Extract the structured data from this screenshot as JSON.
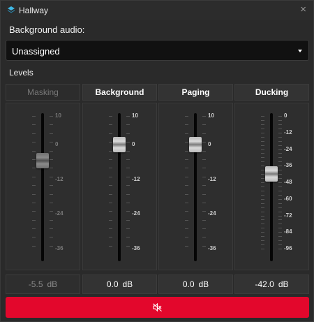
{
  "window": {
    "title": "Hallway",
    "close_glyph": "×"
  },
  "background_audio": {
    "label": "Background audio:",
    "selected": "Unassigned"
  },
  "levels": {
    "label": "Levels",
    "unit": "dB",
    "channels": [
      {
        "name": "Masking",
        "value": "-5.5",
        "level_db": -5.5,
        "enabled": false,
        "scale": [
          "10",
          "0",
          "-12",
          "-24",
          "-36"
        ],
        "range_db": [
          10,
          -36
        ]
      },
      {
        "name": "Background",
        "value": "0.0",
        "level_db": 0,
        "enabled": true,
        "scale": [
          "10",
          "0",
          "-12",
          "-24",
          "-36"
        ],
        "range_db": [
          10,
          -36
        ]
      },
      {
        "name": "Paging",
        "value": "0.0",
        "level_db": 0,
        "enabled": true,
        "scale": [
          "10",
          "0",
          "-12",
          "-24",
          "-36"
        ],
        "range_db": [
          10,
          -36
        ]
      },
      {
        "name": "Ducking",
        "value": "-42.0",
        "level_db": -42,
        "enabled": true,
        "scale": [
          "0",
          "-12",
          "-24",
          "-36",
          "-48",
          "-60",
          "-72",
          "-84",
          "-96"
        ],
        "range_db": [
          0,
          -96
        ]
      }
    ]
  },
  "mute_button": {
    "icon": "speaker-muted-icon",
    "color": "#e3072c"
  },
  "colors": {
    "accent": "#e3072c",
    "app_icon": "#3fb8e6"
  }
}
